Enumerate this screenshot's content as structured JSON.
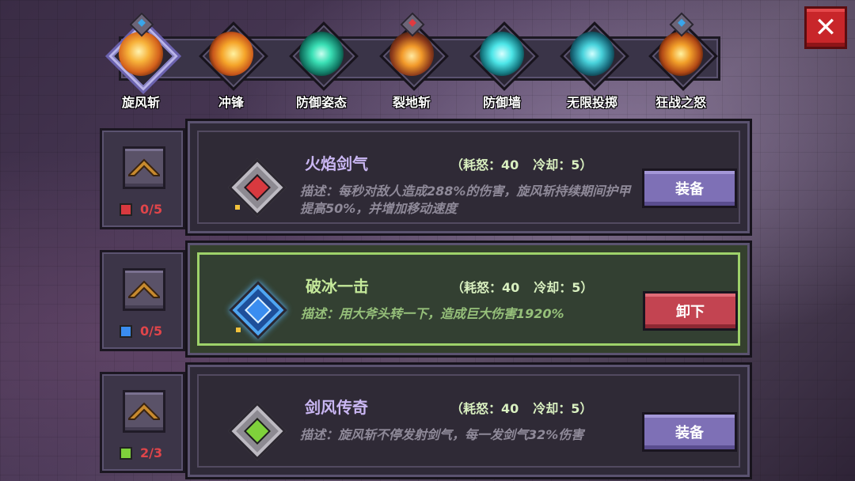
{
  "close": {
    "icon": "close-icon",
    "label": "✕"
  },
  "tabs": [
    {
      "label": "旋风斩",
      "icon": "whirlwind-icon",
      "active": true,
      "pin": "blue"
    },
    {
      "label": "冲锋",
      "icon": "charge-icon"
    },
    {
      "label": "防御姿态",
      "icon": "defense-stance-icon"
    },
    {
      "label": "裂地斩",
      "icon": "ground-slam-icon",
      "pin": "red"
    },
    {
      "label": "防御墙",
      "icon": "defense-wall-icon"
    },
    {
      "label": "无限投掷",
      "icon": "infinite-throw-icon"
    },
    {
      "label": "狂战之怒",
      "icon": "berserker-rage-icon",
      "pin": "blue"
    }
  ],
  "rows": [
    {
      "name": "火焰剑气",
      "cost_label": "（耗怒：40",
      "cooldown_label": "冷却：5）",
      "desc": "描述：每秒对敌人造成288%的伤害，旋风斩持续期间护甲提高50%，并增加移动速度",
      "button": "装备",
      "level": "0/5",
      "rune_color": "#d8393f",
      "level_icon_color": "#d8393f"
    },
    {
      "name": "破冰一击",
      "cost_label": "（耗怒：40",
      "cooldown_label": "冷却：5）",
      "desc": "描述：用大斧头转一下，造成巨大伤害1920%",
      "button": "卸下",
      "level": "0/5",
      "rune_color": "#3a8df0",
      "level_icon_color": "#3a8df0",
      "selected": true
    },
    {
      "name": "剑风传奇",
      "cost_label": "（耗怒：40",
      "cooldown_label": "冷却：5）",
      "desc": "描述：旋风斩不停发射剑气，每一发剑气32%伤害",
      "button": "装备",
      "level": "2/3",
      "rune_color": "#7fd13b",
      "level_icon_color": "#7fd13b"
    }
  ]
}
